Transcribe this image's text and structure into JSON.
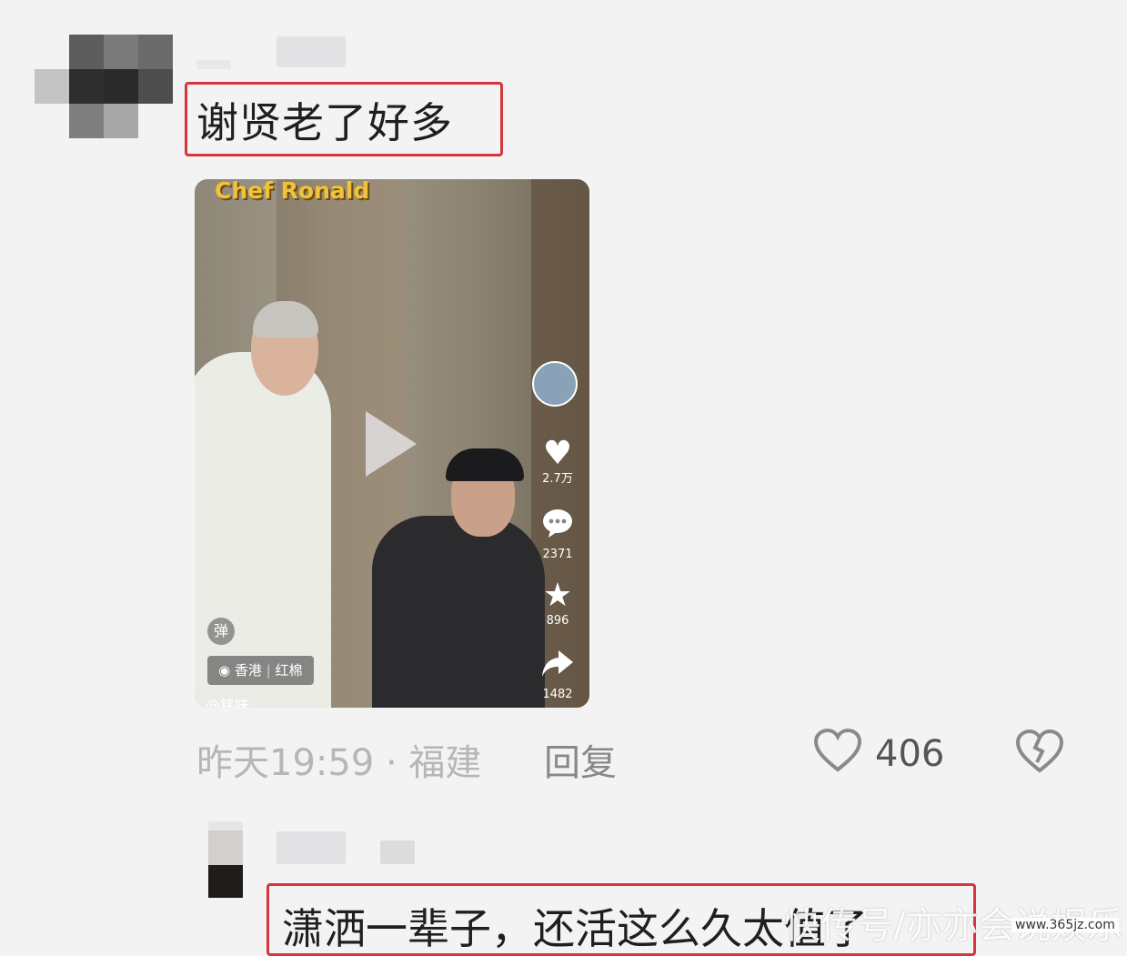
{
  "comment": {
    "text": "谢贤老了好多",
    "time_location": "昨天19:59 · 福建",
    "reply_label": "回复",
    "like_count": "406"
  },
  "video": {
    "watermark_title": "Chef Ronald",
    "likes": "2.7万",
    "comments": "2371",
    "favorites": "896",
    "shares": "1482",
    "danmaku_label": "弹",
    "location": "香港",
    "venue": "红棉",
    "author": "@铭味"
  },
  "reply": {
    "text": "潇洒一辈子，还活这么久太值了"
  },
  "site_watermark": {
    "text": "快传号/亦亦会说娱乐",
    "url": "www.365jz.com"
  },
  "colors": {
    "highlight_border": "#d7343e",
    "background": "#f3f3f3"
  },
  "icons": [
    "heart-icon",
    "broken-heart-icon",
    "comment-bubble-icon",
    "star-icon",
    "share-icon",
    "location-pin-icon",
    "play-icon"
  ]
}
